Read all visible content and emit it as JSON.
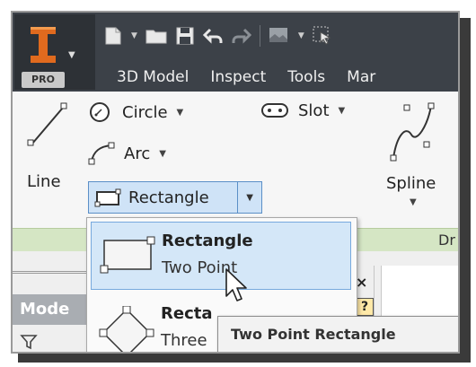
{
  "app": {
    "badge": "PRO"
  },
  "quick_access": {
    "icons": [
      "new-file-icon",
      "open-folder-icon",
      "save-icon",
      "undo-icon",
      "redo-icon",
      "appearance-icon",
      "select-icon"
    ]
  },
  "tabs": [
    {
      "label": "3D Model"
    },
    {
      "label": "Inspect"
    },
    {
      "label": "Tools"
    },
    {
      "label": "Mar"
    }
  ],
  "ribbon": {
    "line_label": "Line",
    "circle_label": "Circle",
    "arc_label": "Arc",
    "slot_label": "Slot",
    "rectangle_label": "Rectangle",
    "spline_label": "Spline"
  },
  "panel": {
    "green_text": "Dr",
    "model_tab_label": "Mode",
    "close_glyph": "×",
    "help_glyph": "?"
  },
  "rectangle_menu": {
    "items": [
      {
        "title": "Rectangle",
        "subtitle": "Two Point",
        "selected": true
      },
      {
        "title": "Recta",
        "subtitle": "Three"
      }
    ]
  },
  "tooltip": {
    "text": "Two Point Rectangle"
  },
  "colors": {
    "accent": "#5b8fc7",
    "title_bar": "#3c4148",
    "logo": "#e06a1e"
  }
}
